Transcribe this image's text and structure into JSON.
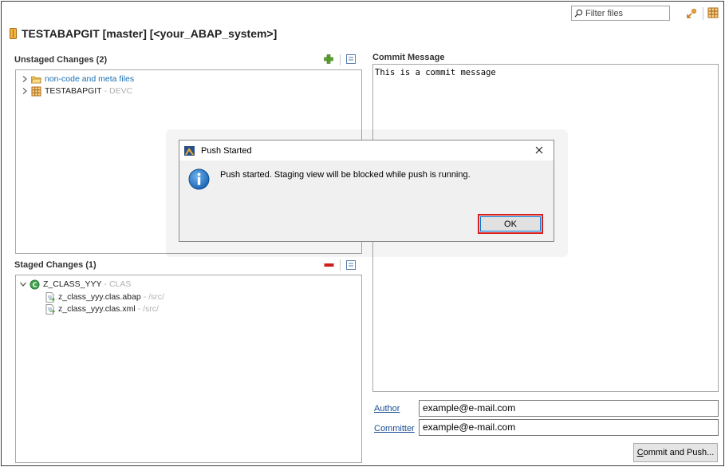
{
  "toolbar": {
    "filter_placeholder": "Filter files"
  },
  "header": {
    "title": "TESTABAPGIT [master] [<your_ABAP_system>]"
  },
  "unstaged": {
    "header": "Unstaged Changes (2)",
    "items": [
      {
        "label": "non-code and meta files",
        "suffix": ""
      },
      {
        "label": "TESTABAPGIT",
        "suffix": "- DEVC"
      }
    ]
  },
  "staged": {
    "header": "Staged Changes (1)",
    "package": {
      "label": "Z_CLASS_YYY",
      "suffix": "- CLAS"
    },
    "files": [
      {
        "label": "z_class_yyy.clas.abap",
        "suffix": "- /src/"
      },
      {
        "label": "z_class_yyy.clas.xml",
        "suffix": "- /src/"
      }
    ]
  },
  "commit": {
    "header": "Commit Message",
    "message": "This is a commit message",
    "author_label": "Author",
    "author_value": "example@e-mail.com",
    "committer_label": "Committer",
    "committer_value": "example@e-mail.com",
    "button_accesskey": "C",
    "button_rest": "ommit and Push..."
  },
  "dialog": {
    "title": "Push Started",
    "message": "Push started. Staging view will be blocked while push is running.",
    "ok_label": "OK"
  },
  "colors": {
    "highlight": "#d62020",
    "link": "#1a6fb0",
    "add_icon": "#5aa02c",
    "remove_icon": "#cc1f1f"
  }
}
